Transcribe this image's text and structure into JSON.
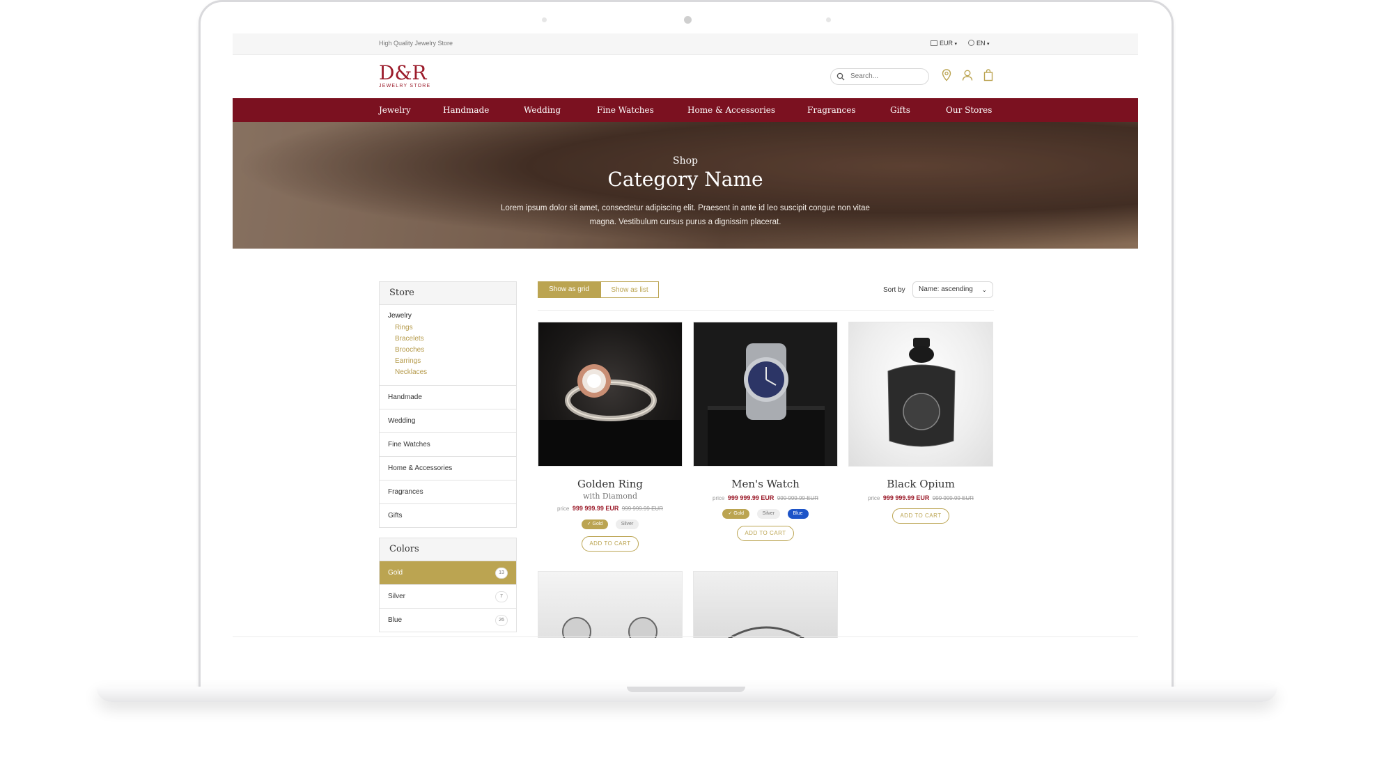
{
  "topbar": {
    "tagline": "High Quality Jewelry Store",
    "currency": "EUR",
    "language": "EN"
  },
  "logo": {
    "mark": "D&R",
    "sub": "JEWELRY STORE"
  },
  "search": {
    "placeholder": "Search..."
  },
  "nav": [
    "Jewelry",
    "Handmade",
    "Wedding",
    "Fine Watches",
    "Home & Accessories",
    "Fragrances",
    "Gifts",
    "Our Stores"
  ],
  "hero": {
    "kicker": "Shop",
    "title": "Category Name",
    "desc_line1": "Lorem ipsum dolor sit amet, consectetur adipiscing elit. Praesent in ante id leo suscipit congue non vitae",
    "desc_line2": "magna. Vestibulum cursus purus a dignissim placerat."
  },
  "store_panel": {
    "title": "Store",
    "main_category": "Jewelry",
    "subcategories": [
      "Rings",
      "Bracelets",
      "Brooches",
      "Earrings",
      "Necklaces"
    ],
    "categories": [
      "Handmade",
      "Wedding",
      "Fine Watches",
      "Home & Accessories",
      "Fragrances",
      "Gifts"
    ]
  },
  "colors_panel": {
    "title": "Colors",
    "items": [
      {
        "label": "Gold",
        "count": "13"
      },
      {
        "label": "Silver",
        "count": "7"
      },
      {
        "label": "Blue",
        "count": "26"
      }
    ]
  },
  "toolbar": {
    "grid_label": "Show as grid",
    "list_label": "Show as list",
    "sort_label": "Sort by",
    "sort_value": "Name: ascending"
  },
  "products": [
    {
      "name": "Golden Ring",
      "sub": "with Diamond",
      "price_label": "price",
      "price": "999 999.99 EUR",
      "old_price": "999 999.99 EUR",
      "chips": [
        "Gold",
        "Silver"
      ],
      "cta": "ADD TO CART"
    },
    {
      "name": "Men's Watch",
      "price_label": "price",
      "price": "999 999.99 EUR",
      "old_price": "999 999.99 EUR",
      "chips": [
        "Gold",
        "Silver",
        "Blue"
      ],
      "cta": "ADD TO CART"
    },
    {
      "name": "Black Opium",
      "price_label": "price",
      "price": "999 999.99 EUR",
      "old_price": "999 999.99 EUR",
      "cta": "ADD TO CART"
    }
  ],
  "colors": {
    "accent_gold": "#bba451",
    "brand_red": "#7b1120"
  }
}
